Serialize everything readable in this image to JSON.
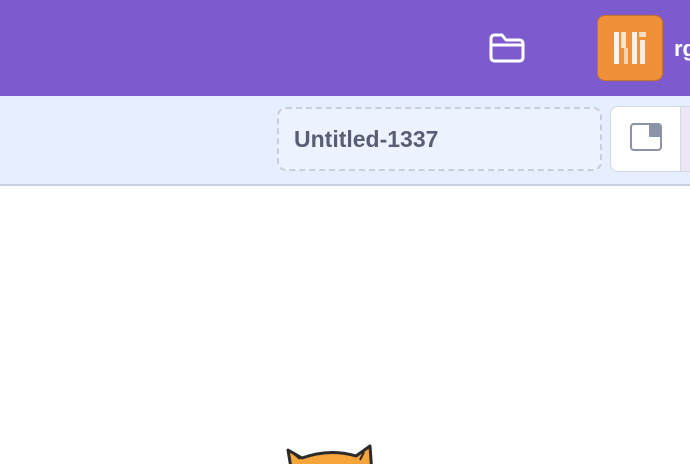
{
  "menubar": {
    "folder_icon": "folder-icon",
    "username": "rg"
  },
  "toolbar": {
    "project_title": "Untitled-1337",
    "stage_layout_icon": "small-stage-icon"
  },
  "stage": {
    "sprite": "cat-sprite"
  },
  "colors": {
    "menubar": "#7d5bce",
    "toolbar": "#e6efff",
    "avatar": "#f0913a",
    "title_text": "#575e75"
  }
}
